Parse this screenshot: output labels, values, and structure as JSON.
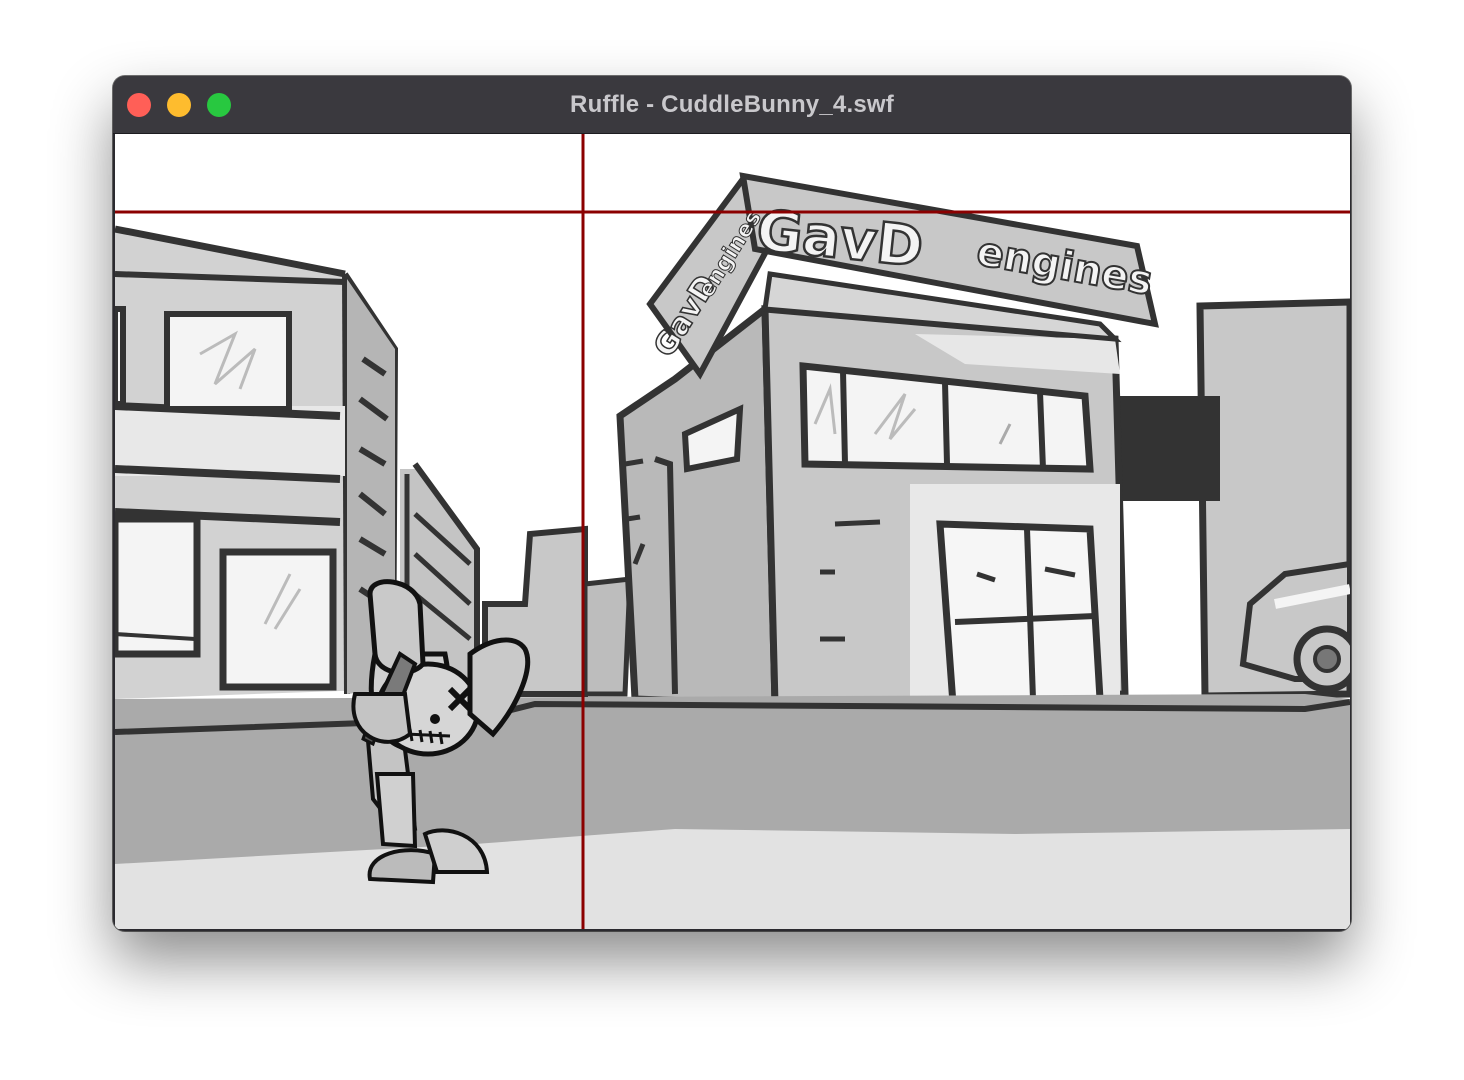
{
  "window": {
    "title": "Ruffle - CuddleBunny_4.swf"
  },
  "scene": {
    "sign_front_left": "GavD",
    "sign_front_right": "engines",
    "sign_side_left": "GavD",
    "sign_side_right": "engines"
  },
  "colors": {
    "titlebar": "#3a393e",
    "guide_lines": "#8b0000",
    "close": "#ff5f57",
    "minimize": "#febc2e",
    "maximize": "#28c840"
  }
}
